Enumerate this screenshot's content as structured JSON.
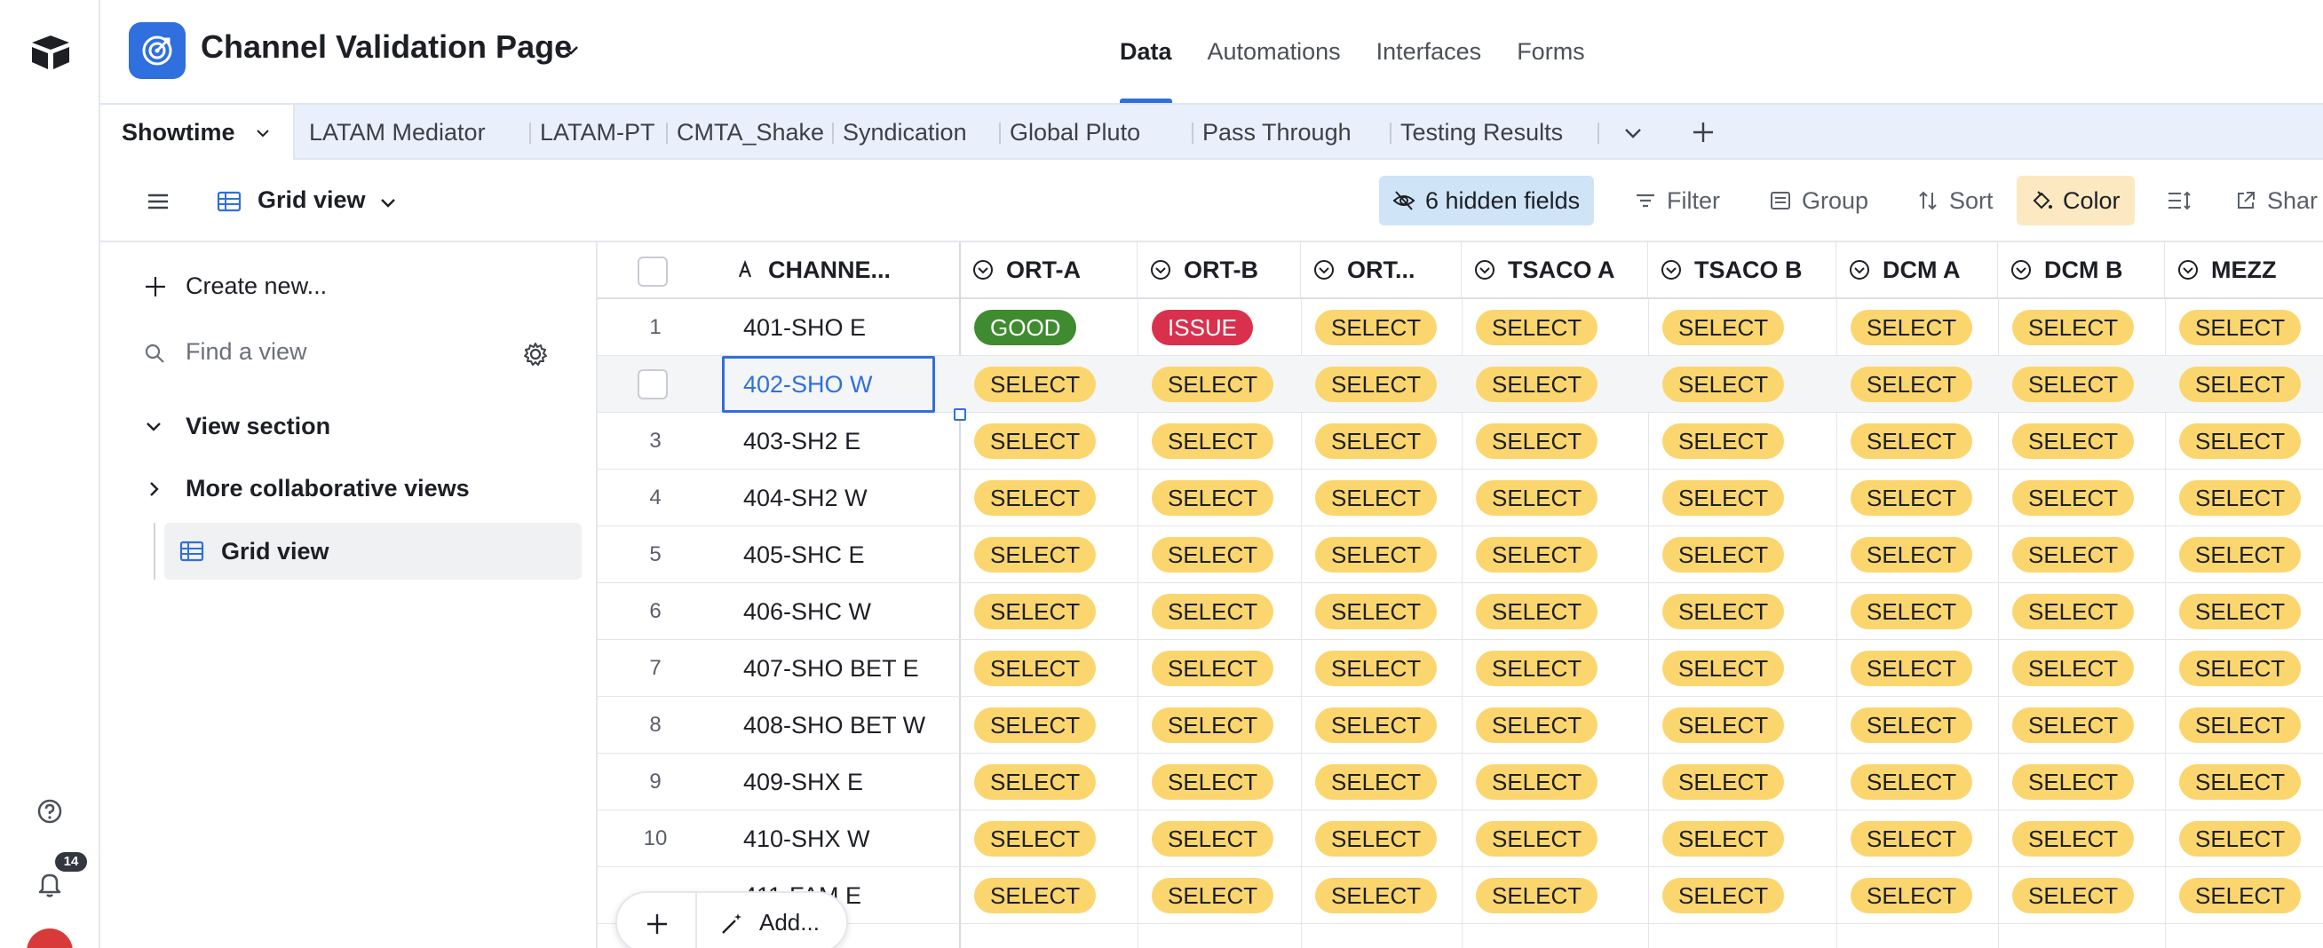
{
  "app": {
    "title": "Channel Validation Page",
    "brand_color": "#2f6fde"
  },
  "rail": {
    "notification_count": "14"
  },
  "top_tabs": [
    {
      "label": "Data",
      "active": true
    },
    {
      "label": "Automations",
      "active": false
    },
    {
      "label": "Interfaces",
      "active": false
    },
    {
      "label": "Forms",
      "active": false
    }
  ],
  "table_tabs": [
    {
      "label": "Showtime",
      "active": true
    },
    {
      "label": "LATAM Mediator"
    },
    {
      "label": "LATAM-PT"
    },
    {
      "label": "CMTA_Shake"
    },
    {
      "label": "Syndication"
    },
    {
      "label": "Global Pluto"
    },
    {
      "label": "Pass Through"
    },
    {
      "label": "Testing Results"
    }
  ],
  "viewbar": {
    "view_name": "Grid view",
    "hidden_fields": "6 hidden fields",
    "filter": "Filter",
    "group": "Group",
    "sort": "Sort",
    "color": "Color",
    "share": "Shar"
  },
  "sidebar": {
    "create_new": "Create new...",
    "find_placeholder": "Find a view",
    "section": "View section",
    "collab": "More collaborative views",
    "view_item": "Grid view"
  },
  "grid": {
    "columns": [
      "CHANNE...",
      "ORT-A",
      "ORT-B",
      "ORT...",
      "TSACO A",
      "TSACO B",
      "DCM A",
      "DCM B",
      "MEZZ"
    ],
    "rows": [
      {
        "num": "1",
        "name": "401-SHO E",
        "values": [
          "GOOD",
          "ISSUE",
          "SELECT",
          "SELECT",
          "SELECT",
          "SELECT",
          "SELECT",
          "SELECT"
        ]
      },
      {
        "num": "",
        "name": "402-SHO W",
        "values": [
          "SELECT",
          "SELECT",
          "SELECT",
          "SELECT",
          "SELECT",
          "SELECT",
          "SELECT",
          "SELECT"
        ]
      },
      {
        "num": "3",
        "name": "403-SH2 E",
        "values": [
          "SELECT",
          "SELECT",
          "SELECT",
          "SELECT",
          "SELECT",
          "SELECT",
          "SELECT",
          "SELECT"
        ]
      },
      {
        "num": "4",
        "name": "404-SH2 W",
        "values": [
          "SELECT",
          "SELECT",
          "SELECT",
          "SELECT",
          "SELECT",
          "SELECT",
          "SELECT",
          "SELECT"
        ]
      },
      {
        "num": "5",
        "name": "405-SHC E",
        "values": [
          "SELECT",
          "SELECT",
          "SELECT",
          "SELECT",
          "SELECT",
          "SELECT",
          "SELECT",
          "SELECT"
        ]
      },
      {
        "num": "6",
        "name": "406-SHC W",
        "values": [
          "SELECT",
          "SELECT",
          "SELECT",
          "SELECT",
          "SELECT",
          "SELECT",
          "SELECT",
          "SELECT"
        ]
      },
      {
        "num": "7",
        "name": "407-SHO BET E",
        "values": [
          "SELECT",
          "SELECT",
          "SELECT",
          "SELECT",
          "SELECT",
          "SELECT",
          "SELECT",
          "SELECT"
        ]
      },
      {
        "num": "8",
        "name": "408-SHO BET W",
        "values": [
          "SELECT",
          "SELECT",
          "SELECT",
          "SELECT",
          "SELECT",
          "SELECT",
          "SELECT",
          "SELECT"
        ]
      },
      {
        "num": "9",
        "name": "409-SHX E",
        "values": [
          "SELECT",
          "SELECT",
          "SELECT",
          "SELECT",
          "SELECT",
          "SELECT",
          "SELECT",
          "SELECT"
        ]
      },
      {
        "num": "10",
        "name": "410-SHX W",
        "values": [
          "SELECT",
          "SELECT",
          "SELECT",
          "SELECT",
          "SELECT",
          "SELECT",
          "SELECT",
          "SELECT"
        ]
      },
      {
        "num": "",
        "name": "411-FAM E",
        "values": [
          "SELECT",
          "SELECT",
          "SELECT",
          "SELECT",
          "SELECT",
          "SELECT",
          "SELECT",
          "SELECT"
        ]
      }
    ]
  },
  "add_button": {
    "label": "Add..."
  }
}
